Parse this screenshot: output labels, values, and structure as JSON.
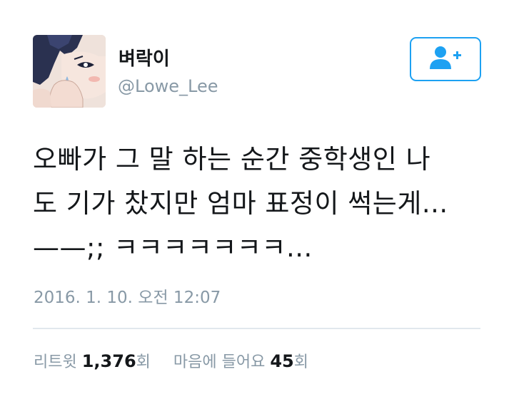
{
  "user": {
    "display_name": "벼락이",
    "handle": "@Lowe_Lee",
    "avatar_icon": "anime-avatar-image"
  },
  "follow_button": {
    "icon": "follow-user-icon",
    "accent_color": "#1da1f2"
  },
  "tweet": {
    "text": "오빠가 그 말 하는 순간 중학생인 나\n도 기가 찼지만 엄마 표정이 썩는게...\n——;; ㅋㅋㅋㅋㅋㅋㅋ...",
    "timestamp": "2016. 1. 10. 오전 12:07"
  },
  "stats": {
    "retweets_label": "리트윗",
    "retweets_count": "1,376",
    "retweets_unit": "회",
    "likes_label": "마음에 들어요",
    "likes_count": "45",
    "likes_unit": "회"
  }
}
